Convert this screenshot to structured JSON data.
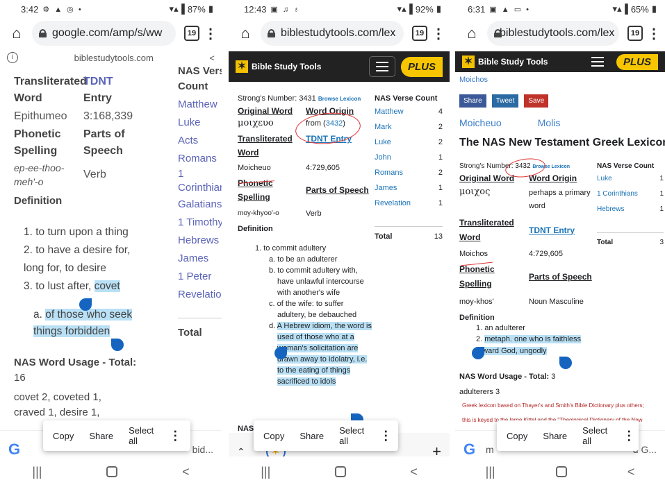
{
  "colors": {
    "accent": "#5a63b8",
    "selection": "#b9e0f5",
    "handle": "#1565c0",
    "toolbar": "#222222",
    "plus": "#f7c600",
    "annotation": "#dd3333"
  },
  "p1": {
    "status": {
      "time": "3:42",
      "battery": "87%"
    },
    "url": "google.com/amp/s/ww",
    "tabs": "19",
    "amp_domain": "biblestudytools.com",
    "labels": {
      "translit": "Transliterated",
      "word": "Word",
      "tdnt": "TDNT",
      "entry": "Entry",
      "phonetic": "Phonetic",
      "spelling": "Spelling",
      "parts": "Parts of",
      "speech": "Speech",
      "definition": "Definition"
    },
    "values": {
      "translit": "Epithumeo",
      "tdnt": "3:168,339",
      "phonetic": "ep-ee-thoo-meh'-o",
      "parts": "Verb"
    },
    "defs": [
      "1. to turn upon a thing",
      "2. to have a desire for, long for, to desire",
      "3. to lust after, ",
      "covet"
    ],
    "subdef_prefix": "a. ",
    "subdef": "of those who seek things forbidden",
    "side": {
      "title1": "NAS Verse",
      "title2": "Count",
      "books": [
        "Matthew",
        "Luke",
        "Acts",
        "Romans",
        "1",
        "Corinthians",
        "Galatians",
        "1 Timothy",
        "Hebrews",
        "James",
        "1 Peter",
        "Revelation"
      ],
      "total": "Total"
    },
    "usage_title": "NAS Word Usage - Total:",
    "usage_total": "16",
    "usage_text": "covet 2, coveted 1,",
    "usage_text2": "craved 1, desire 1,",
    "popup": {
      "copy": "Copy",
      "share": "Share",
      "select_all": "Select all"
    },
    "cab_tail": "bid..."
  },
  "p2": {
    "status": {
      "time": "12:43",
      "battery": "92%"
    },
    "url": "biblestudytools.com/lex",
    "tabs": "19",
    "brand": "Bible Study Tools",
    "plus": "PLUS",
    "strongs_label": "Strong's Number:",
    "strongs": "3431",
    "browse": "Browse Lexicon",
    "labels": {
      "orig": "Original Word",
      "origin": "Word Origin",
      "translit1": "Transliterated",
      "translit2": "Word",
      "tdnt": "TDNT Entry",
      "phonetic1": "Phonetic",
      "phonetic2": "Spelling",
      "parts": "Parts of Speech",
      "definition": "Definition"
    },
    "values": {
      "orig": "μοιχευο",
      "origin_pre": "from (",
      "origin_link": "3432",
      "origin_post": ")",
      "translit": "Moicheuo",
      "tdnt": "4:729,605",
      "phonetic": "moy-khyoo'-o",
      "parts": "Verb"
    },
    "count_title": "NAS Verse Count",
    "counts": [
      {
        "book": "Matthew",
        "n": "4"
      },
      {
        "book": "Mark",
        "n": "2"
      },
      {
        "book": "Luke",
        "n": "2"
      },
      {
        "book": "John",
        "n": "1"
      },
      {
        "book": "Romans",
        "n": "2"
      },
      {
        "book": "James",
        "n": "1"
      },
      {
        "book": "Revelation",
        "n": "1"
      }
    ],
    "total_label": "Total",
    "total": "13",
    "def1": "1. to commit adultery",
    "subs": [
      "a. to be an adulterer",
      "b. to commit adultery with, have unlawful intercourse with another's wife",
      "c. of the wife: to suffer adultery, be debauched"
    ],
    "sub_d_prefix": "d. ",
    "sub_d": "A Hebrew idiom, the word is used of those who at a woman's solicitation are drawn away to idolatry, i.e. to the eating of things sacrificed to idols",
    "nas_cut": "NAS",
    "popup": {
      "copy": "Copy",
      "share": "Share",
      "select_all": "Select all"
    }
  },
  "p3": {
    "status": {
      "time": "6:31",
      "battery": "65%"
    },
    "url": "biblestudytools.com/lex",
    "tabs": "19",
    "brand": "Bible Study Tools",
    "plus": "PLUS",
    "partial_top": "Moichos",
    "share_btns": [
      "Share",
      "Tweet",
      "Save"
    ],
    "words": [
      "Moicheuo",
      "Molis"
    ],
    "heading": "The NAS New Testament Greek Lexicon",
    "strongs_label": "Strong's Number:",
    "strongs": "3432",
    "browse": "Browse Lexicon",
    "labels": {
      "orig": "Original Word",
      "origin": "Word Origin",
      "translit1": "Transliterated",
      "translit2": "Word",
      "tdnt": "TDNT Entry",
      "phonetic1": "Phonetic",
      "phonetic2": "Spelling",
      "parts": "Parts of Speech",
      "definition": "Definition"
    },
    "values": {
      "orig": "μοιχος",
      "origin1": "perhaps a primary",
      "origin2": "word",
      "translit": "Moichos",
      "tdnt": "4:729,605",
      "phonetic": "moy-khos'",
      "parts": "Noun Masculine"
    },
    "count_title": "NAS Verse Count",
    "counts": [
      {
        "book": "Luke",
        "n": "1"
      },
      {
        "book": "1 Corinthians",
        "n": "1"
      },
      {
        "book": "Hebrews",
        "n": "1"
      }
    ],
    "total_label": "Total",
    "total": "3",
    "def1": "1. an adulterer",
    "def2_prefix": "2. ",
    "def2": "metaph. one who is faithless toward God, ungodly",
    "usage_title": "NAS Word Usage - Total:",
    "usage_total": "3",
    "usage_text": "adulterers 3",
    "red1": "Greek lexicon based on Thayer's and Smith's Bible Dictionary plus others;",
    "red2": "this is keyed to the large Kittel and the \"Theological Dictionary of the New",
    "popup": {
      "copy": "Copy",
      "share": "Share",
      "select_all": "Select all"
    },
    "cab_pre": "m",
    "cab_tail": "d G..."
  }
}
